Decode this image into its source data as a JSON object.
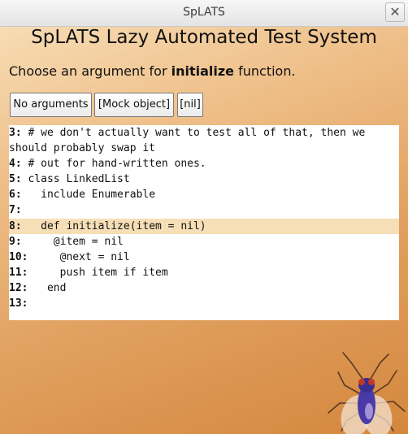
{
  "window": {
    "title": "SpLATS"
  },
  "heading": "SpLATS Lazy Automated Test System",
  "prompt": {
    "prefix": "Choose an argument for ",
    "function_name": "initialize",
    "suffix": " function."
  },
  "buttons": [
    {
      "label": "No arguments"
    },
    {
      "label": "[Mock object]"
    },
    {
      "label": "[nil]"
    }
  ],
  "code_lines": [
    {
      "num": "3:",
      "text": " # we don't actually want to test all of that, then we"
    },
    {
      "num": "",
      "text": "should probably swap it"
    },
    {
      "num": "4:",
      "text": " # out for hand-written ones."
    },
    {
      "num": "5:",
      "text": " class LinkedList"
    },
    {
      "num": "6:",
      "text": "   include Enumerable"
    },
    {
      "num": "7:",
      "text": ""
    },
    {
      "num": "8:",
      "text": "   def initialize(item = nil)",
      "highlighted": true
    },
    {
      "num": "9:",
      "text": "     @item = nil"
    },
    {
      "num": "10:",
      "text": "     @next = nil"
    },
    {
      "num": "11:",
      "text": "     push item if item"
    },
    {
      "num": "12:",
      "text": "   end"
    },
    {
      "num": "13:",
      "text": ""
    }
  ],
  "colors": {
    "highlight": "#f6dfb7",
    "background_gradient_light": "#f7dcb4",
    "background_gradient_dark": "#d4873e"
  },
  "icons": {
    "close": "close-icon",
    "mascot": "fly-mascot-icon"
  }
}
